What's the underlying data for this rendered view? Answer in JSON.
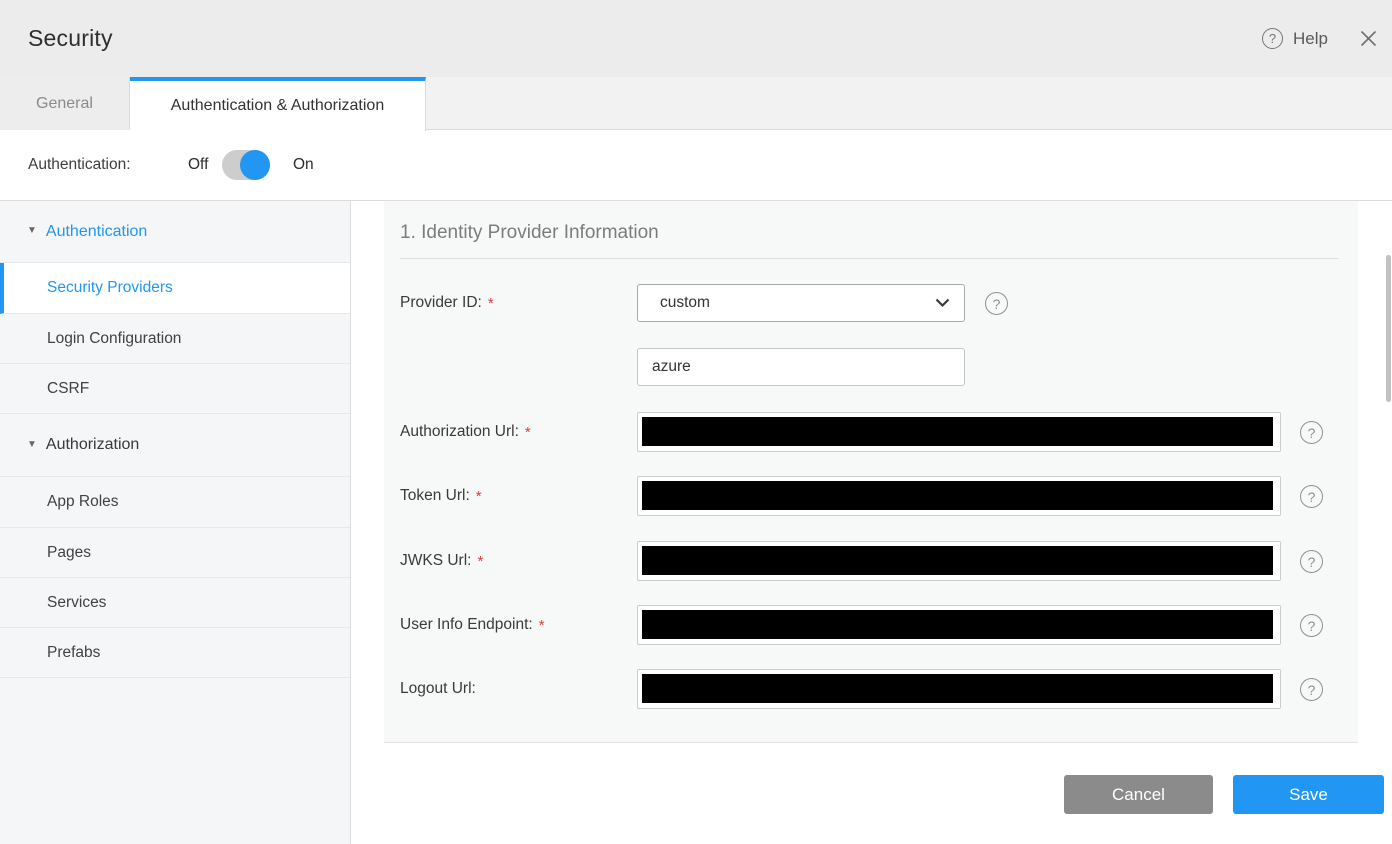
{
  "header": {
    "title": "Security",
    "help_label": "Help",
    "help_icon": "?"
  },
  "tabs": [
    {
      "label": "General",
      "active": false
    },
    {
      "label": "Authentication & Authorization",
      "active": true
    }
  ],
  "auth_toggle": {
    "label": "Authentication:",
    "off_label": "Off",
    "on_label": "On",
    "state": "on"
  },
  "sidebar": {
    "groups": [
      {
        "label": "Authentication",
        "collapse_icon": "▼",
        "expanded": true,
        "items": [
          {
            "label": "Security Providers",
            "selected": true
          },
          {
            "label": "Login Configuration",
            "selected": false
          },
          {
            "label": "CSRF",
            "selected": false
          }
        ]
      },
      {
        "label": "Authorization",
        "collapse_icon": "▼",
        "expanded": true,
        "items": [
          {
            "label": "App Roles",
            "selected": false
          },
          {
            "label": "Pages",
            "selected": false
          },
          {
            "label": "Services",
            "selected": false
          },
          {
            "label": "Prefabs",
            "selected": false
          }
        ]
      }
    ]
  },
  "form": {
    "section_title": "1. Identity Provider Information",
    "help_icon": "?",
    "fields": [
      {
        "label": "Provider ID:",
        "required_marker": "*",
        "type": "select",
        "value": "custom",
        "help": true
      },
      {
        "label": "",
        "type": "text",
        "value": "azure",
        "help": false
      },
      {
        "label": "Authorization Url:",
        "required_marker": "*",
        "type": "redacted",
        "value": "",
        "help": true
      },
      {
        "label": "Token Url:",
        "required_marker": "*",
        "type": "redacted",
        "value": "",
        "help": true
      },
      {
        "label": "JWKS Url:",
        "required_marker": "*",
        "type": "redacted",
        "value": "",
        "help": true
      },
      {
        "label": "User Info Endpoint:",
        "required_marker": "*",
        "type": "redacted",
        "value": "",
        "help": true
      },
      {
        "label": "Logout Url:",
        "type": "redacted",
        "value": "",
        "help": true
      }
    ]
  },
  "footer": {
    "cancel_label": "Cancel",
    "save_label": "Save"
  },
  "colors": {
    "accent": "#2196f3",
    "cancel_gray": "#8b8b8b",
    "required_red": "#e53935",
    "redaction": "#000000"
  }
}
